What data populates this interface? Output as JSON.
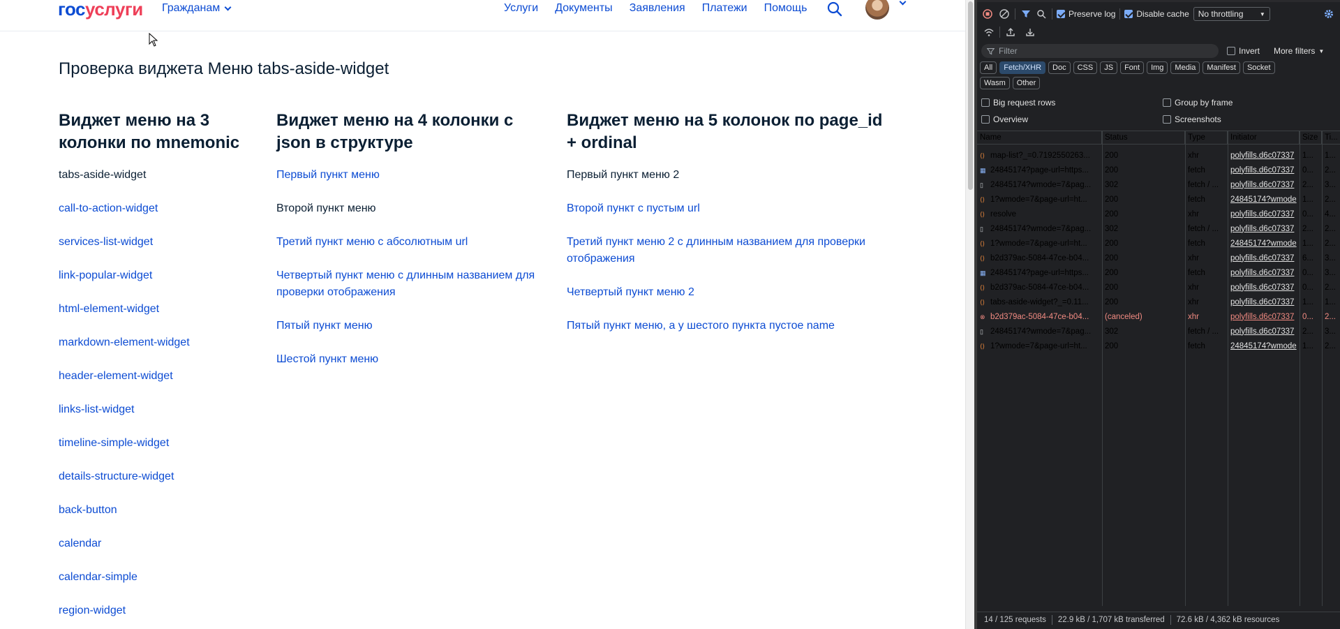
{
  "site": {
    "logo": {
      "part1": "гос",
      "part2": "услуги"
    },
    "nav_citizens": "Гражданам",
    "nav": [
      "Услуги",
      "Документы",
      "Заявления",
      "Платежи",
      "Помощь"
    ],
    "page_title": "Проверка виджета Меню tabs-aside-widget",
    "columns": [
      {
        "title": "Виджет меню на 3 колонки по mnemonic",
        "items": [
          {
            "label": "tabs-aside-widget",
            "link": false
          },
          {
            "label": "call-to-action-widget",
            "link": true
          },
          {
            "label": "services-list-widget",
            "link": true
          },
          {
            "label": "link-popular-widget",
            "link": true
          },
          {
            "label": "html-element-widget",
            "link": true
          },
          {
            "label": "markdown-element-widget",
            "link": true
          },
          {
            "label": "header-element-widget",
            "link": true
          },
          {
            "label": "links-list-widget",
            "link": true
          },
          {
            "label": "timeline-simple-widget",
            "link": true
          },
          {
            "label": "details-structure-widget",
            "link": true
          },
          {
            "label": "back-button",
            "link": true
          },
          {
            "label": "calendar",
            "link": true
          },
          {
            "label": "calendar-simple",
            "link": true
          },
          {
            "label": "region-widget",
            "link": true
          }
        ]
      },
      {
        "title": "Виджет меню на 4 колонки с json в структуре",
        "items": [
          {
            "label": "Первый пункт меню",
            "link": true
          },
          {
            "label": "Второй пункт меню",
            "link": false
          },
          {
            "label": "Третий пункт меню с абсолютным url",
            "link": true
          },
          {
            "label": "Четвертый пункт меню с длинным названием для проверки отображения",
            "link": true
          },
          {
            "label": "Пятый пункт меню",
            "link": true
          },
          {
            "label": "Шестой пункт меню",
            "link": true
          }
        ]
      },
      {
        "title": "Виджет меню на 5 колонок по page_id + ordinal",
        "items": [
          {
            "label": "Первый пункт меню 2",
            "link": false
          },
          {
            "label": "Второй пункт с пустым url",
            "link": true
          },
          {
            "label": "Третий пункт меню 2 с длинным названием для проверки отображения",
            "link": true
          },
          {
            "label": "Четвертый пункт меню 2",
            "link": true
          },
          {
            "label": "Пятый пункт меню, а у шестого пункта пустое name",
            "link": true
          }
        ]
      }
    ]
  },
  "devtools": {
    "toolbar": {
      "preserve_log": "Preserve log",
      "disable_cache": "Disable cache",
      "throttling": "No throttling"
    },
    "filter": {
      "placeholder": "Filter",
      "invert": "Invert",
      "more_filters": "More filters"
    },
    "types": [
      "All",
      "Fetch/XHR",
      "Doc",
      "CSS",
      "JS",
      "Font",
      "Img",
      "Media",
      "Manifest",
      "Socket",
      "Wasm",
      "Other"
    ],
    "active_type": "Fetch/XHR",
    "options": {
      "big_rows": "Big request rows",
      "group_frame": "Group by frame",
      "overview": "Overview",
      "screenshots": "Screenshots"
    },
    "columns": [
      "Name",
      "Status",
      "Type",
      "Initiator",
      "Size",
      "Ti..."
    ],
    "rows": [
      {
        "icon": "xhr",
        "name": "map-list?_=0.7192550263...",
        "status": "200",
        "type": "xhr",
        "initiator": "polyfills.d6c07337",
        "size": "1...",
        "time": "1..."
      },
      {
        "icon": "img",
        "name": "24845174?page-url=https...",
        "status": "200",
        "type": "fetch",
        "initiator": "polyfills.d6c07337",
        "size": "0...",
        "time": "2..."
      },
      {
        "icon": "doc",
        "name": "24845174?wmode=7&pag...",
        "status": "302",
        "type": "fetch / ...",
        "initiator": "polyfills.d6c07337",
        "size": "2...",
        "time": "3..."
      },
      {
        "icon": "xhr",
        "name": "1?wmode=7&page-url=ht...",
        "status": "200",
        "type": "fetch",
        "initiator": "24845174?wmode",
        "size": "1...",
        "time": "2..."
      },
      {
        "icon": "xhr",
        "name": "resolve",
        "status": "200",
        "type": "xhr",
        "initiator": "polyfills.d6c07337",
        "size": "0...",
        "time": "4..."
      },
      {
        "icon": "doc",
        "name": "24845174?wmode=7&pag...",
        "status": "302",
        "type": "fetch / ...",
        "initiator": "polyfills.d6c07337",
        "size": "2...",
        "time": "2..."
      },
      {
        "icon": "xhr",
        "name": "1?wmode=7&page-url=ht...",
        "status": "200",
        "type": "fetch",
        "initiator": "24845174?wmode",
        "size": "1...",
        "time": "2..."
      },
      {
        "icon": "xhr",
        "name": "b2d379ac-5084-47ce-b04...",
        "status": "200",
        "type": "xhr",
        "initiator": "polyfills.d6c07337",
        "size": "6...",
        "time": "3..."
      },
      {
        "icon": "img",
        "name": "24845174?page-url=https...",
        "status": "200",
        "type": "fetch",
        "initiator": "polyfills.d6c07337",
        "size": "0...",
        "time": "3..."
      },
      {
        "icon": "xhr",
        "name": "b2d379ac-5084-47ce-b04...",
        "status": "200",
        "type": "xhr",
        "initiator": "polyfills.d6c07337",
        "size": "0...",
        "time": "2..."
      },
      {
        "icon": "xhr",
        "name": "tabs-aside-widget?_=0.11...",
        "status": "200",
        "type": "xhr",
        "initiator": "polyfills.d6c07337",
        "size": "1...",
        "time": "1..."
      },
      {
        "icon": "err",
        "name": "b2d379ac-5084-47ce-b04...",
        "status": "(canceled)",
        "type": "xhr",
        "initiator": "polyfills.d6c07337",
        "size": "0...",
        "time": "2..."
      },
      {
        "icon": "doc",
        "name": "24845174?wmode=7&pag...",
        "status": "302",
        "type": "fetch / ...",
        "initiator": "polyfills.d6c07337",
        "size": "2...",
        "time": "3..."
      },
      {
        "icon": "xhr",
        "name": "1?wmode=7&page-url=ht...",
        "status": "200",
        "type": "fetch",
        "initiator": "24845174?wmode",
        "size": "1...",
        "time": "2..."
      }
    ],
    "summary": {
      "requests": "14 / 125 requests",
      "transferred": "22.9 kB / 1,707 kB transferred",
      "resources": "72.6 kB / 4,362 kB resources"
    }
  },
  "colors": {
    "link": "#0d4cd3",
    "text": "#0b1f33",
    "logo_red": "#ee3f58",
    "devtools_bg": "#202124",
    "error": "#f28b82"
  }
}
